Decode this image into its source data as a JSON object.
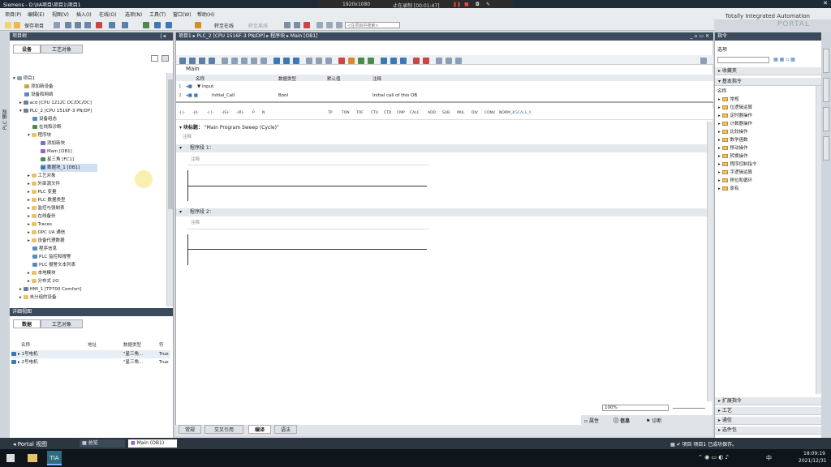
{
  "window": {
    "title": "Siemens - D:\\IIA项目\\项目1\\项目1"
  },
  "recorder": {
    "resolution": "1920x1080",
    "status": "止在录制 [00:01:47]"
  },
  "menu": [
    "项目(P)",
    "编辑(E)",
    "视图(V)",
    "插入(I)",
    "在线(O)",
    "选项(N)",
    "工具(T)",
    "窗口(W)",
    "帮助(H)"
  ],
  "brand": {
    "line1": "Totally Integrated Automation",
    "line2": "PORTAL"
  },
  "toolbar": {
    "save_label": "保存项目",
    "go_online": "转至在线",
    "go_offline": "转至离线",
    "search_placeholder": "<在项目中搜索>"
  },
  "left": {
    "title": "项目树",
    "tabs": [
      "设备",
      "工艺对象"
    ],
    "side_label": "PLC 编程",
    "tree": [
      "项目1",
      "添加新设备",
      "设备和网络",
      "acd [CPU 1212C DC/DC/DC]",
      "PLC_2 [CPU 1516F-3 PN/DP]",
      "设备组态",
      "在线和诊断",
      "程序块",
      "添加新块",
      "Main [OB1]",
      "星三角 [FC1]",
      "数据块_1 [DB1]",
      "工艺对象",
      "外部源文件",
      "PLC 变量",
      "PLC 数据类型",
      "监控与强制表",
      "在线备份",
      "Traces",
      "OPC UA 通信",
      "设备代理数据",
      "程序信息",
      "PLC 监控和报警",
      "PLC 报警文本列表",
      "本地模块",
      "分布式 I/O",
      "HMI_1 [TP700 Comfort]",
      "未分组的设备"
    ]
  },
  "detail": {
    "title": "详细视图",
    "tabs": [
      "数据",
      "工艺对象"
    ],
    "cols": [
      "名称",
      "地址",
      "数据类型",
      "符"
    ],
    "rows": [
      {
        "name": "1号电机",
        "type": "\"星三角...",
        "val": "True"
      },
      {
        "name": "2号电机",
        "type": "\"星三角...",
        "val": "True"
      }
    ]
  },
  "center": {
    "breadcrumb": "项目1 ▸ PLC_2 [CPU 1516F-3 PN/DP] ▸ 程序块 ▸ Main [OB1]",
    "block_name": "Main",
    "iface_headers": [
      "名称",
      "数据类型",
      "默认值",
      "注释"
    ],
    "iface_rows": [
      {
        "n": "1",
        "name": "▼ Input",
        "type": "",
        "comment": ""
      },
      {
        "n": "2",
        "name": "Initial_Call",
        "type": "Bool",
        "comment": "Initial call of this OB"
      }
    ],
    "ladder_tools": [
      "-| |-",
      "-|/|-",
      "-( )-",
      "-(S)-",
      "-(R)-",
      "P",
      "N",
      "TP",
      "TON",
      "TOF",
      "CTU",
      "CTD",
      "CMP",
      "CALC",
      "ADD",
      "SUB",
      "MUL",
      "DIV",
      "CONV",
      "NORM_X",
      "SCALE_X"
    ],
    "block_title_label": "块标题：",
    "block_title_value": "\"Main Program Sweep (Cycle)\"",
    "comment": "注释",
    "networks": [
      {
        "title": "程序段 1：",
        "comment": "注释"
      },
      {
        "title": "程序段 2：",
        "comment": "注释"
      }
    ],
    "zoom": "100%",
    "bottom_tabs": [
      "常规",
      "交叉引用",
      "编译",
      "语法"
    ],
    "inspector_tabs": [
      "属性",
      "信息",
      "诊断"
    ]
  },
  "right": {
    "title": "指令",
    "options": "选项",
    "favorites": "收藏夹",
    "basic": "基本指令",
    "name_col": "名称",
    "items": [
      "常规",
      "位逻辑运算",
      "定时器操作",
      "计数器操作",
      "比较操作",
      "数学函数",
      "移动操作",
      "转换操作",
      "程序控制指令",
      "字逻辑运算",
      "移位和循环",
      "原有"
    ],
    "ext": "扩展指令",
    "tech": "工艺",
    "comm": "通信",
    "opt": "选件包"
  },
  "portal": {
    "label": "Portal 视图",
    "overview": "总览",
    "open": "Main (OB1)",
    "status": "项目 项目1 已成功保存。"
  },
  "taskbar": {
    "ime": "中",
    "time": "18:09:19",
    "date": "2021/12/31"
  }
}
